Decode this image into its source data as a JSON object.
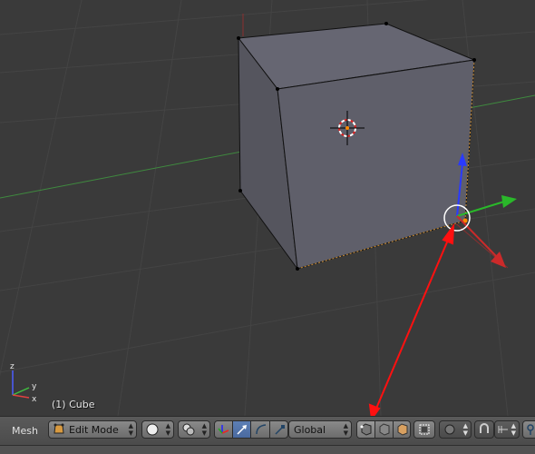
{
  "viewport": {
    "object_label": "(1) Cube",
    "axis_labels": {
      "x": "x",
      "y": "y",
      "z": "z"
    }
  },
  "header": {
    "editor_menu": "Mesh",
    "mode_select": "Edit Mode",
    "transform_orientation": "Global"
  },
  "icons": [
    "mode-icon",
    "viewport-shading-icon",
    "pivot-point-icon",
    "manipulator-toggle-icon",
    "translate-icon",
    "rotate-icon",
    "scale-icon",
    "vertex-select-icon",
    "edge-select-icon",
    "face-select-icon",
    "limit-selection-icon",
    "proportional-edit-icon",
    "snap-icon",
    "snap-element-icon",
    "render-icon"
  ],
  "colors": {
    "viewport_bg": "#3a3a3a",
    "cube_face": "#5f5f6a",
    "x_axis": "#cc2a2a",
    "y_axis": "#2ab82a",
    "z_axis": "#2a3aff",
    "active_button": "#5d7fb5",
    "annotation_arrow": "#ff1010"
  }
}
